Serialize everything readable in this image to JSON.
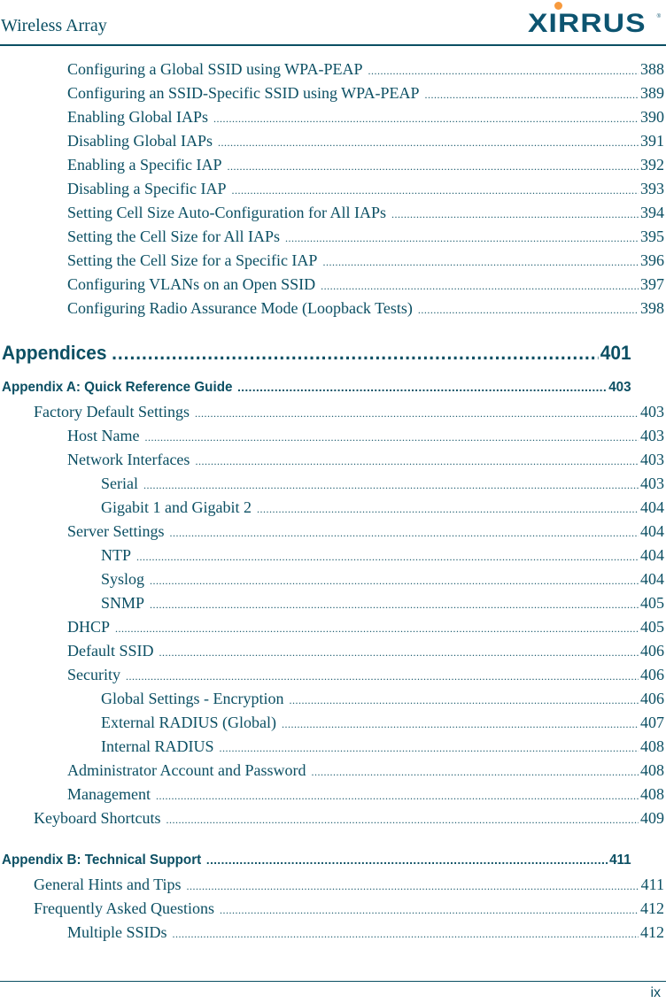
{
  "header": {
    "title": "Wireless Array",
    "logo_text": "XIRRUS",
    "logo_reg": "®",
    "accent_color": "#0b4f63",
    "logo_dot_color": "#f79a3e"
  },
  "toc": [
    {
      "label": "Configuring a Global SSID using WPA-PEAP",
      "page": "388",
      "level": 2,
      "style": "serif"
    },
    {
      "label": "Configuring an SSID-Specific SSID using WPA-PEAP",
      "page": "389",
      "level": 2,
      "style": "serif"
    },
    {
      "label": "Enabling Global IAPs",
      "page": "390",
      "level": 2,
      "style": "serif"
    },
    {
      "label": "Disabling Global IAPs",
      "page": "391",
      "level": 2,
      "style": "serif"
    },
    {
      "label": "Enabling a Specific IAP",
      "page": "392",
      "level": 2,
      "style": "serif"
    },
    {
      "label": "Disabling a Specific IAP",
      "page": "393",
      "level": 2,
      "style": "serif"
    },
    {
      "label": "Setting Cell Size Auto-Configuration for All IAPs",
      "page": "394",
      "level": 2,
      "style": "serif"
    },
    {
      "label": "Setting the Cell Size for All IAPs",
      "page": "395",
      "level": 2,
      "style": "serif"
    },
    {
      "label": "Setting the Cell Size for a Specific IAP",
      "page": "396",
      "level": 2,
      "style": "serif"
    },
    {
      "label": "Configuring VLANs on an Open SSID",
      "page": "397",
      "level": 2,
      "style": "serif"
    },
    {
      "label": "Configuring Radio Assurance Mode (Loopback Tests)",
      "page": "398",
      "level": 2,
      "style": "serif"
    },
    {
      "label": "Appendices",
      "page": "401",
      "level": 0,
      "style": "sans-h1"
    },
    {
      "label": "Appendix A: Quick Reference Guide",
      "page": "403",
      "level": 0,
      "style": "sans-h2"
    },
    {
      "label": "Factory Default Settings",
      "page": "403",
      "level": 1,
      "style": "serif"
    },
    {
      "label": "Host Name",
      "page": "403",
      "level": 2,
      "style": "serif"
    },
    {
      "label": "Network Interfaces",
      "page": "403",
      "level": 2,
      "style": "serif"
    },
    {
      "label": "Serial",
      "page": "403",
      "level": 3,
      "style": "serif"
    },
    {
      "label": "Gigabit 1 and Gigabit 2",
      "page": "404",
      "level": 3,
      "style": "serif"
    },
    {
      "label": "Server Settings",
      "page": "404",
      "level": 2,
      "style": "serif"
    },
    {
      "label": "NTP",
      "page": "404",
      "level": 3,
      "style": "serif"
    },
    {
      "label": "Syslog",
      "page": "404",
      "level": 3,
      "style": "serif"
    },
    {
      "label": "SNMP",
      "page": "405",
      "level": 3,
      "style": "serif"
    },
    {
      "label": "DHCP",
      "page": "405",
      "level": 2,
      "style": "serif"
    },
    {
      "label": "Default SSID",
      "page": "406",
      "level": 2,
      "style": "serif"
    },
    {
      "label": "Security",
      "page": "406",
      "level": 2,
      "style": "serif"
    },
    {
      "label": "Global Settings - Encryption",
      "page": "406",
      "level": 3,
      "style": "serif"
    },
    {
      "label": "External RADIUS (Global)",
      "page": "407",
      "level": 3,
      "style": "serif"
    },
    {
      "label": "Internal RADIUS",
      "page": "408",
      "level": 3,
      "style": "serif"
    },
    {
      "label": "Administrator Account and Password",
      "page": "408",
      "level": 2,
      "style": "serif"
    },
    {
      "label": "Management",
      "page": "408",
      "level": 2,
      "style": "serif"
    },
    {
      "label": "Keyboard Shortcuts",
      "page": "409",
      "level": 1,
      "style": "serif"
    },
    {
      "label": "Appendix B: Technical Support",
      "page": "411",
      "level": 0,
      "style": "sans-h2"
    },
    {
      "label": "General Hints and Tips",
      "page": "411",
      "level": 1,
      "style": "serif"
    },
    {
      "label": "Frequently Asked Questions",
      "page": "412",
      "level": 1,
      "style": "serif"
    },
    {
      "label": "Multiple SSIDs",
      "page": "412",
      "level": 2,
      "style": "serif"
    }
  ],
  "footer": {
    "page_number": "ix"
  }
}
